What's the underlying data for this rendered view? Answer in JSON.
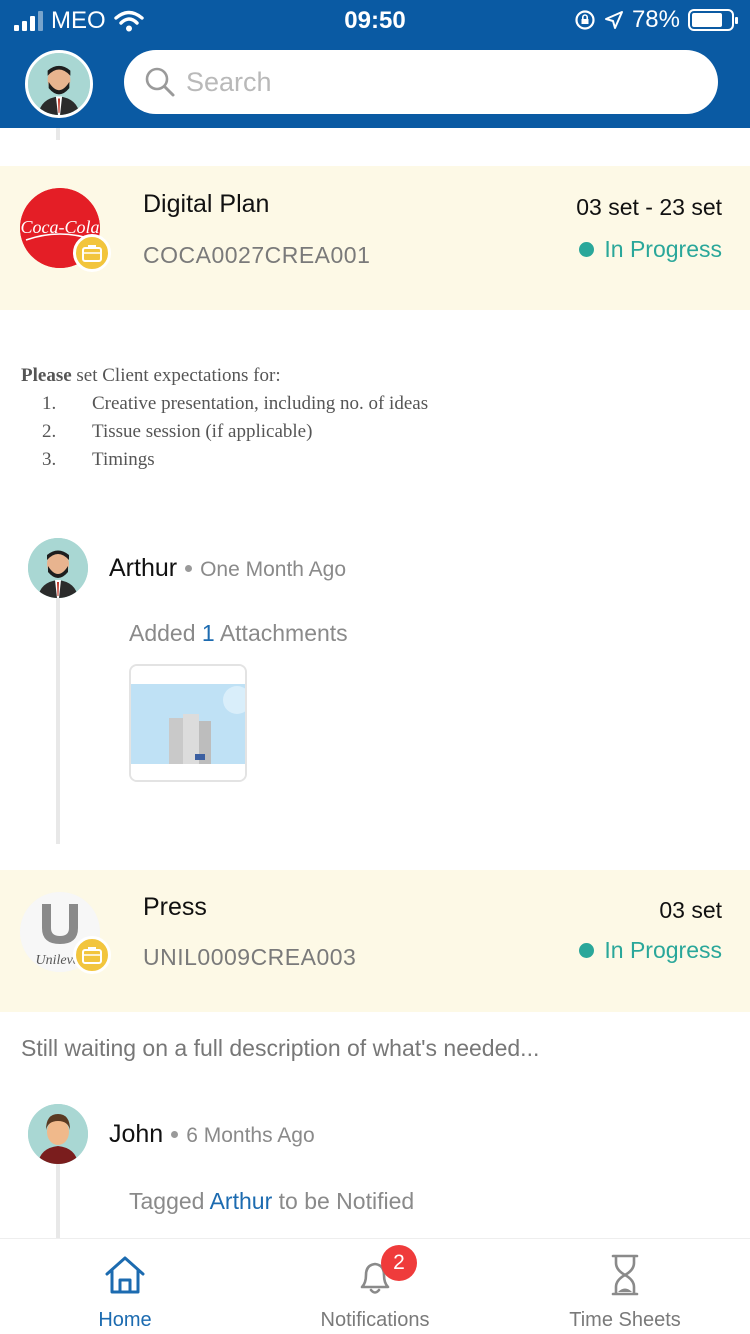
{
  "status_bar": {
    "carrier": "MEO",
    "time": "09:50",
    "battery": "78%"
  },
  "header": {
    "search_placeholder": "Search"
  },
  "feed": {
    "task1": {
      "title": "Digital Plan",
      "code": "COCA0027CREA001",
      "dates": "03 set - 23 set",
      "status": "In Progress",
      "brand": "Coca-Cola",
      "description": {
        "lead_bold": "Please",
        "lead_rest": " set Client expectations for:",
        "items": [
          {
            "num": "1.",
            "text": "Creative presentation, including no. of ideas"
          },
          {
            "num": "2.",
            "text": "Tissue session (if applicable)"
          },
          {
            "num": "3.",
            "text": "Timings"
          }
        ]
      },
      "activity": {
        "user": "Arthur",
        "time": "One Month Ago",
        "prefix": "Added ",
        "count": "1",
        "suffix": " Attachments"
      }
    },
    "task2": {
      "title": "Press",
      "code": "UNIL0009CREA003",
      "dates": "03 set",
      "status": "In Progress",
      "brand": "Unilever",
      "description": "Still waiting on a full description of what's needed...",
      "activity": {
        "user": "John",
        "time": "6 Months Ago",
        "prefix": "Tagged ",
        "tagged_user": "Arthur",
        "suffix": " to be Notified"
      }
    }
  },
  "tabbar": {
    "tabs": [
      {
        "label": "Home",
        "icon": "home-icon",
        "active": true
      },
      {
        "label": "Notifications",
        "icon": "bell-icon",
        "badge": "2"
      },
      {
        "label": "Time Sheets",
        "icon": "hourglass-icon"
      }
    ]
  },
  "colors": {
    "header_blue": "#0a5aa3",
    "status_green": "#2aa79a",
    "card_bg": "#fdf9e6",
    "badge_yellow": "#f2c53d",
    "notif_red": "#ef3b3b",
    "link_blue": "#1c6bb0"
  }
}
